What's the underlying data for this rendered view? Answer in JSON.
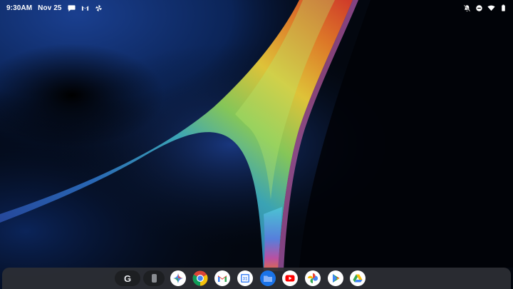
{
  "status": {
    "time": "9:30AM",
    "date": "Nov 25",
    "left_icons": [
      "message-icon",
      "gmail-icon",
      "pinwheel-icon"
    ],
    "right_icons": [
      "notifications-off-icon",
      "do-not-disturb-icon",
      "wifi-icon",
      "battery-icon"
    ]
  },
  "taskbar": {
    "search_glyph": "G",
    "apps": [
      "Gemini",
      "Chrome",
      "Gmail",
      "Calendar",
      "Files",
      "YouTube",
      "Photos",
      "Play Store",
      "Drive"
    ],
    "calendar_day": "31"
  },
  "colors": {
    "wall_base": "#03070f",
    "taskbar_bg": "#2d2f34",
    "pill_bg": "#1d1f22"
  }
}
